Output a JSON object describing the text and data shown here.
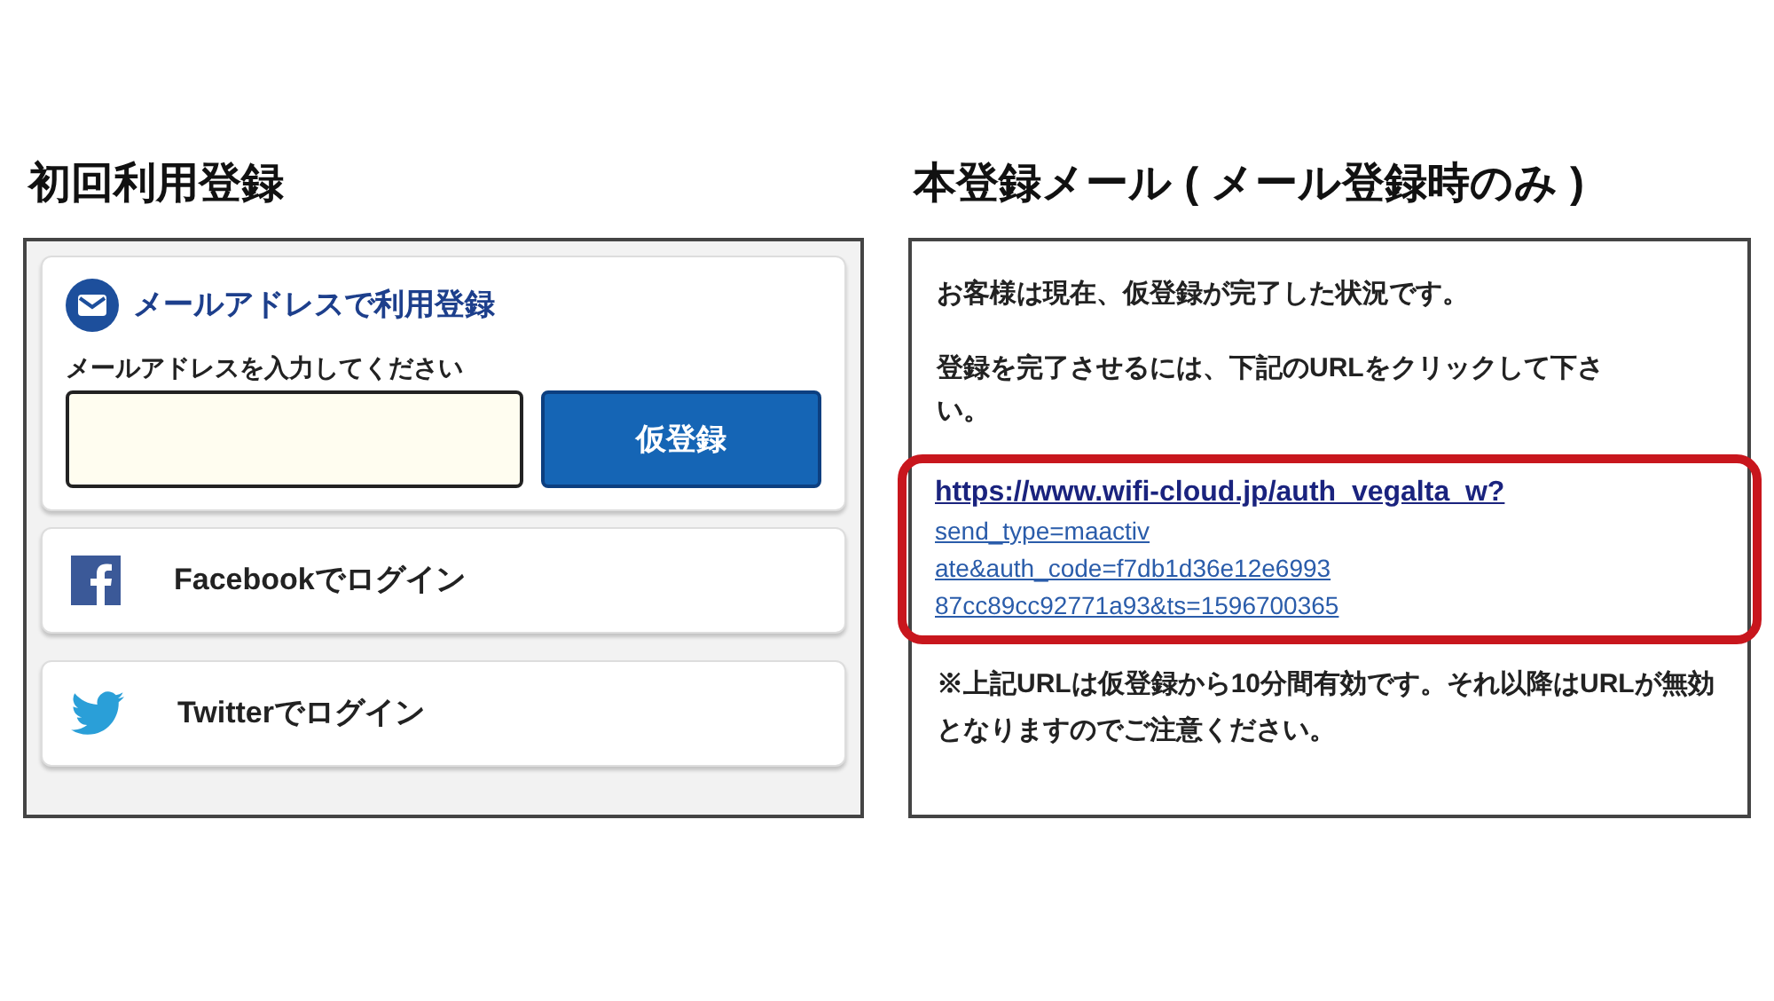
{
  "left": {
    "title": "初回利用登録",
    "email_card": {
      "heading": "メールアドレスで利用登録",
      "label": "メールアドレスを入力してください",
      "button": "仮登録"
    },
    "social_buttons": [
      {
        "kind": "facebook",
        "label": "Facebookでログイン"
      },
      {
        "kind": "twitter",
        "label": "Twitterでログイン"
      }
    ]
  },
  "right": {
    "title": "本登録メール ( メール登録時のみ )",
    "paragraphs": [
      "お客様は現在、仮登録が完了した状況です。",
      "登録を完了させるには、下記のURLをクリックして下さい。"
    ],
    "url_lines": [
      "https://www.wifi-cloud.jp/auth_vegalta_w?",
      "send_type=maactiv",
      "ate&auth_code=f7db1d36e12e6993",
      "87cc89cc92771a93&ts=1596700365"
    ],
    "note": "※上記URLは仮登録から10分間有効です。それ以降はURLが無効となりますのでご注意ください。"
  }
}
